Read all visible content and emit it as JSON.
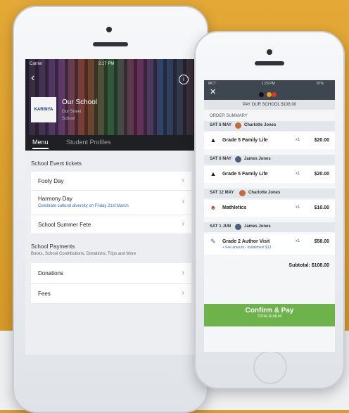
{
  "left_screen": {
    "status_bar": {
      "carrier": "Carrier",
      "time": "2:17 PM"
    },
    "back_icon": "chevron-left-icon",
    "info_icon": "info-icon",
    "school": {
      "name": "Our School",
      "street": "Our Street",
      "suburb": "School",
      "logo_text": "KARINYA"
    },
    "tabs": [
      {
        "label": "Menu"
      },
      {
        "label": "Student Profiles"
      }
    ],
    "events_section": {
      "title": "School Event tickets",
      "items": [
        {
          "title": "Footy Day",
          "desc": ""
        },
        {
          "title": "Harmony Day",
          "desc": "Celebrate cultural diversity on Friday 21st March"
        },
        {
          "title": "School Summer Fete",
          "desc": ""
        }
      ]
    },
    "payments_section": {
      "title": "School Payments",
      "subtitle": "Books, School Contributions, Donations, Trips and More",
      "items": [
        {
          "title": "Donations"
        },
        {
          "title": "Fees"
        }
      ]
    }
  },
  "right_screen": {
    "status_bar": {
      "carrier": "MCT",
      "time": "1:23 PM",
      "battery": "87%"
    },
    "pay_header": "PAY OUR SCHOOL $108.00",
    "order_summary": "ORDER SUMMARY",
    "groups": [
      {
        "date": "SAT 6 MAY",
        "student": "Charlotte Jones",
        "items": [
          {
            "icon": "▲",
            "title": "Grade 5 Family Life",
            "qty": "x1",
            "price": "$20.00",
            "extra": ""
          }
        ]
      },
      {
        "date": "SAT 6 MAY",
        "student": "James Jones",
        "items": [
          {
            "icon": "▲",
            "title": "Grade 5 Family Life",
            "qty": "x1",
            "price": "$20.00",
            "extra": ""
          }
        ]
      },
      {
        "date": "SAT 12 MAY",
        "student": "Charlotte Jones",
        "items": [
          {
            "icon": "♣",
            "title": "Mathletics",
            "qty": "x1",
            "price": "$10.00",
            "extra": ""
          }
        ]
      },
      {
        "date": "SAT 1 JUN",
        "student": "James Jones",
        "items": [
          {
            "icon": "✎",
            "title": "Grade 2 Author Visit",
            "qty": "x1",
            "price": "$58.00",
            "extra": "+ Fee amount - Installment $13"
          }
        ]
      }
    ],
    "subtotal": "Subtotal: $108.00",
    "confirm": {
      "label": "Confirm & Pay",
      "sub": "TOTAL $108.00"
    }
  }
}
